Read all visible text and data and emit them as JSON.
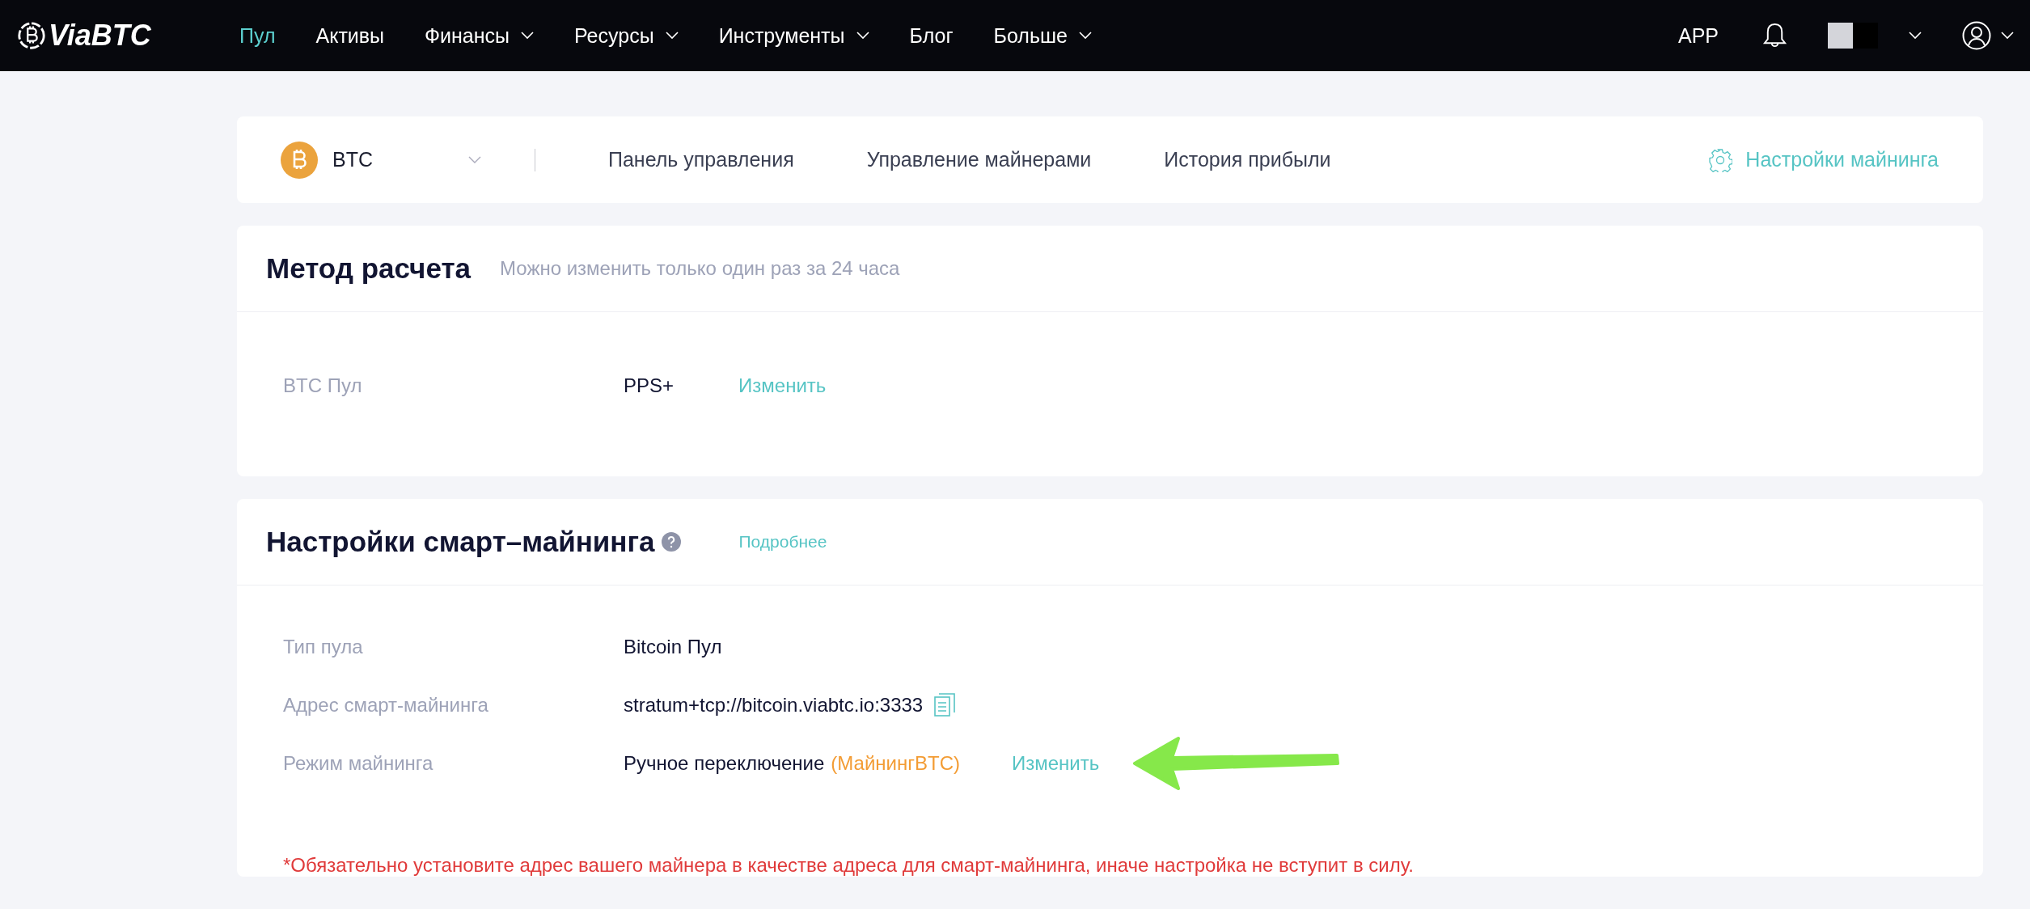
{
  "header": {
    "logo": "ViaBTC",
    "nav": [
      {
        "label": "Пул",
        "selected": true,
        "dropdown": false
      },
      {
        "label": "Активы",
        "selected": false,
        "dropdown": false
      },
      {
        "label": "Финансы",
        "selected": false,
        "dropdown": true
      },
      {
        "label": "Ресурсы",
        "selected": false,
        "dropdown": true
      },
      {
        "label": "Инструменты",
        "selected": false,
        "dropdown": true
      },
      {
        "label": "Блог",
        "selected": false,
        "dropdown": false
      },
      {
        "label": "Больше",
        "selected": false,
        "dropdown": true
      }
    ],
    "app": "APP"
  },
  "toolbar": {
    "coin": "BTC",
    "tabs": [
      {
        "label": "Панель управления",
        "selected": false
      },
      {
        "label": "Управление майнерами",
        "selected": false
      },
      {
        "label": "История прибыли",
        "selected": false
      }
    ],
    "settings_link": "Настройки майнинга"
  },
  "settlement": {
    "title": "Метод расчета",
    "hint": "Можно изменить только один раз за 24 часа",
    "rows": [
      {
        "kind": "action",
        "label": "BTC Пул",
        "value": "PPS+",
        "action": "Изменить"
      }
    ]
  },
  "smart": {
    "title": "Настройки смарт–майнинга",
    "more_link": "Подробнее",
    "rows": [
      {
        "kind": "plain",
        "label": "Тип пула",
        "value": "Bitcoin Пул"
      },
      {
        "kind": "copy",
        "label": "Адрес смарт-майнинга",
        "value": "stratum+tcp://bitcoin.viabtc.io:3333"
      },
      {
        "kind": "action-arrow",
        "label": "Режим майнинга",
        "value": "Ручное переключение",
        "note": "(МайнингBTC)",
        "action": "Изменить"
      }
    ],
    "warning": "*Обязательно установите адрес вашего майнера в качестве адреса для смарт-майнинга, иначе настройка не вступит в силу."
  }
}
